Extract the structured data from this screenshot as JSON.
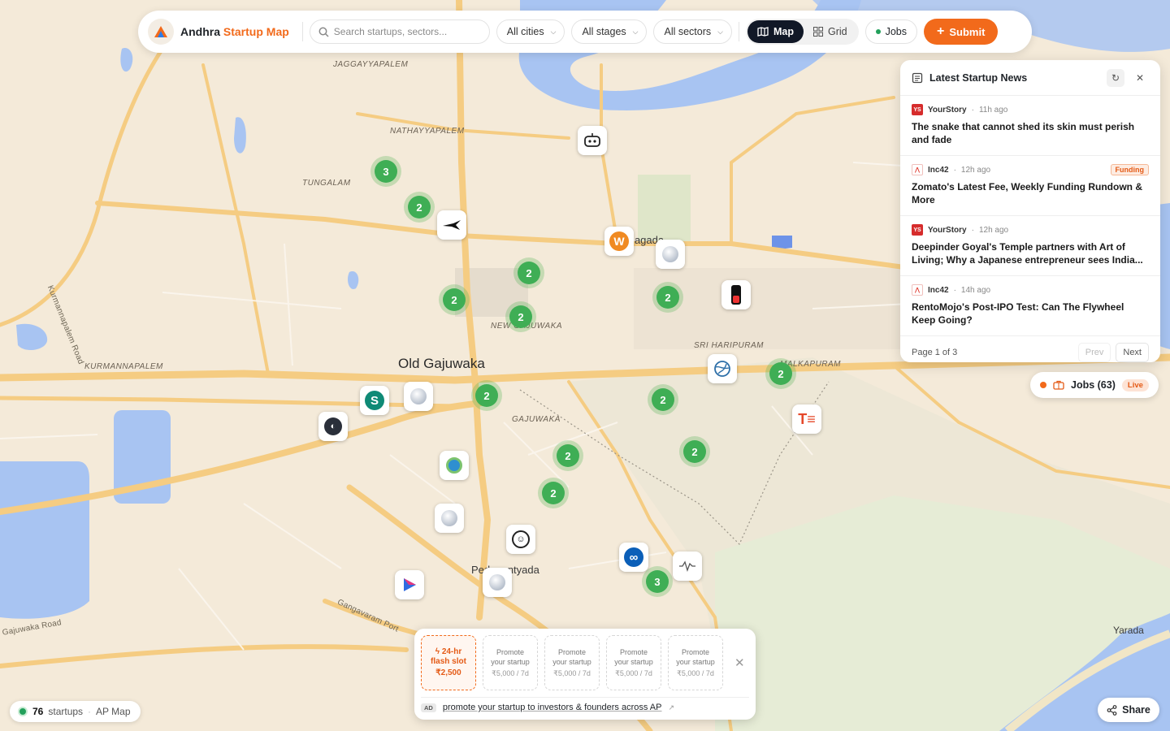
{
  "header": {
    "brand_first": "Andhra",
    "brand_accent": "Startup Map",
    "search_placeholder": "Search startups, sectors...",
    "filters": {
      "cities": "All cities",
      "stages": "All stages",
      "sectors": "All sectors"
    },
    "view_map": "Map",
    "view_grid": "Grid",
    "jobs": "Jobs",
    "submit": "Submit"
  },
  "map": {
    "places": {
      "jaggayyapalem": "JAGGAYYAPALEM",
      "nathayyapalem": "NATHAYYAPALEM",
      "tungalam": "TUNGALAM",
      "kurmannapalem": "KURMANNAPALEM",
      "kurmannapalem_road": "Kurmannapalem Road",
      "old_gajuwaka": "Old Gajuwaka",
      "gajuwaka": "GAJUWAKA",
      "new_gajuwaka": "NEW GAJUWAKA",
      "sri_haripuram": "SRI HARIPURAM",
      "malkapuram": "MALKAPURAM",
      "mulagada": "Mulagada",
      "pedagantyada": "Pedagantyada",
      "gangavaram_port": "Gangavaram Port",
      "gajuwaka_road": "Gajuwaka Road",
      "yarada": "Yarada"
    },
    "clusters": [
      "3",
      "2",
      "2",
      "2",
      "2",
      "2",
      "2",
      "2",
      "2",
      "2",
      "2",
      "2",
      "3"
    ]
  },
  "news": {
    "title": "Latest Startup News",
    "items": [
      {
        "source": "YourStory",
        "time": "11h ago",
        "badge": "",
        "headline": "The snake that cannot shed its skin must perish and fade"
      },
      {
        "source": "Inc42",
        "time": "12h ago",
        "badge": "Funding",
        "headline": "Zomato's Latest Fee, Weekly Funding Rundown & More"
      },
      {
        "source": "YourStory",
        "time": "12h ago",
        "badge": "",
        "headline": "Deepinder Goyal's Temple partners with Art of Living; Why a Japanese entrepreneur sees India..."
      },
      {
        "source": "Inc42",
        "time": "14h ago",
        "badge": "",
        "headline": "RentoMojo's Post-IPO Test: Can The Flywheel Keep Going?"
      }
    ],
    "page_label": "Page 1 of 3",
    "prev": "Prev",
    "next": "Next"
  },
  "jobs_float": {
    "label": "Jobs (63)",
    "live": "Live"
  },
  "ad": {
    "flash": {
      "line1": "24-hr",
      "line2": "flash slot",
      "price": "₹2,500"
    },
    "slots": [
      {
        "line1": "Promote",
        "line2": "your startup",
        "price": "₹5,000 / 7d"
      },
      {
        "line1": "Promote",
        "line2": "your startup",
        "price": "₹5,000 / 7d"
      },
      {
        "line1": "Promote",
        "line2": "your startup",
        "price": "₹5,000 / 7d"
      },
      {
        "line1": "Promote",
        "line2": "your startup",
        "price": "₹5,000 / 7d"
      }
    ],
    "tag": "AD",
    "link": "promote your startup to investors & founders across AP"
  },
  "footer": {
    "count": "76",
    "count_label": "startups",
    "map_label": "AP Map",
    "share": "Share"
  },
  "colors": {
    "accent": "#f26a1b",
    "cluster": "#3fae55",
    "water": "#a8c4f2",
    "road": "#f5cc82"
  }
}
